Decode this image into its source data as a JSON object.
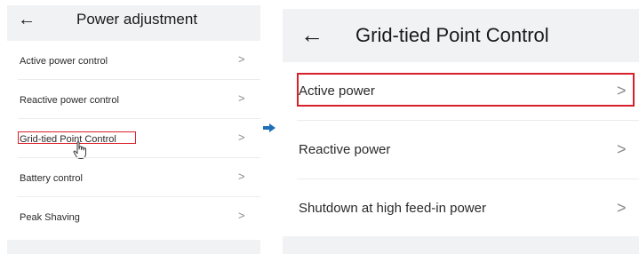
{
  "colors": {
    "highlight": "#d8202a",
    "arrow": "#1e6fb8",
    "panel_bg": "#f1f2f4",
    "list_bg": "#ffffff"
  },
  "left_screen": {
    "back_icon": "arrow-left-icon",
    "back_glyph": "←",
    "title": "Power adjustment",
    "items": [
      {
        "label": "Active power control",
        "chevron": ">"
      },
      {
        "label": "Reactive power control",
        "chevron": ">"
      },
      {
        "label": "Grid-tied Point Control",
        "chevron": ">",
        "highlighted": true
      },
      {
        "label": "Battery control",
        "chevron": ">"
      },
      {
        "label": "Peak Shaving",
        "chevron": ">"
      }
    ],
    "cursor_icon": "hand-pointer-icon"
  },
  "transition_icon": "arrow-right-icon",
  "right_screen": {
    "back_icon": "arrow-left-icon",
    "back_glyph": "←",
    "title": "Grid-tied Point Control",
    "items": [
      {
        "label": "Active power",
        "chevron": ">",
        "highlighted": true
      },
      {
        "label": "Reactive power",
        "chevron": ">"
      },
      {
        "label": "Shutdown at high feed-in power",
        "chevron": ">"
      }
    ]
  }
}
